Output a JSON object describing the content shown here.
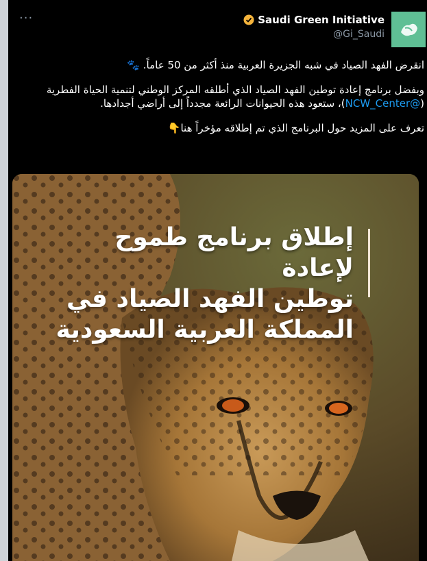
{
  "tweet": {
    "display_name": "Saudi Green Initiative",
    "handle": "@Gi_Saudi",
    "more_label": "···",
    "paragraph1": "انقرض الفهد الصياد في شبه الجزيرة العربية منذ أكثر من 50 عاماً. 🐾",
    "paragraph2_before": "وبفضل برنامج إعادة توطين الفهد الصياد الذي أطلقه المركز الوطني لتنمية الحياة الفطرية (",
    "paragraph2_link": "@NCW_Center",
    "paragraph2_after": ")، ستعود هذه الحيوانات الرائعة مجدداً إلى أراضي أجدادها.",
    "paragraph3": "تعرف على المزيد حول البرنامج الذي تم إطلاقه مؤخراً هنا👇"
  },
  "media": {
    "headline_line1": "إطلاق برنامج طموح لإعادة",
    "headline_line2": "توطين الفهد الصياد في",
    "headline_line3": "المملكة العربية السعودية"
  },
  "colors": {
    "background": "#000000",
    "link": "#1d9bf0",
    "avatar": "#5fbf95",
    "verified": "#f5b43c"
  }
}
